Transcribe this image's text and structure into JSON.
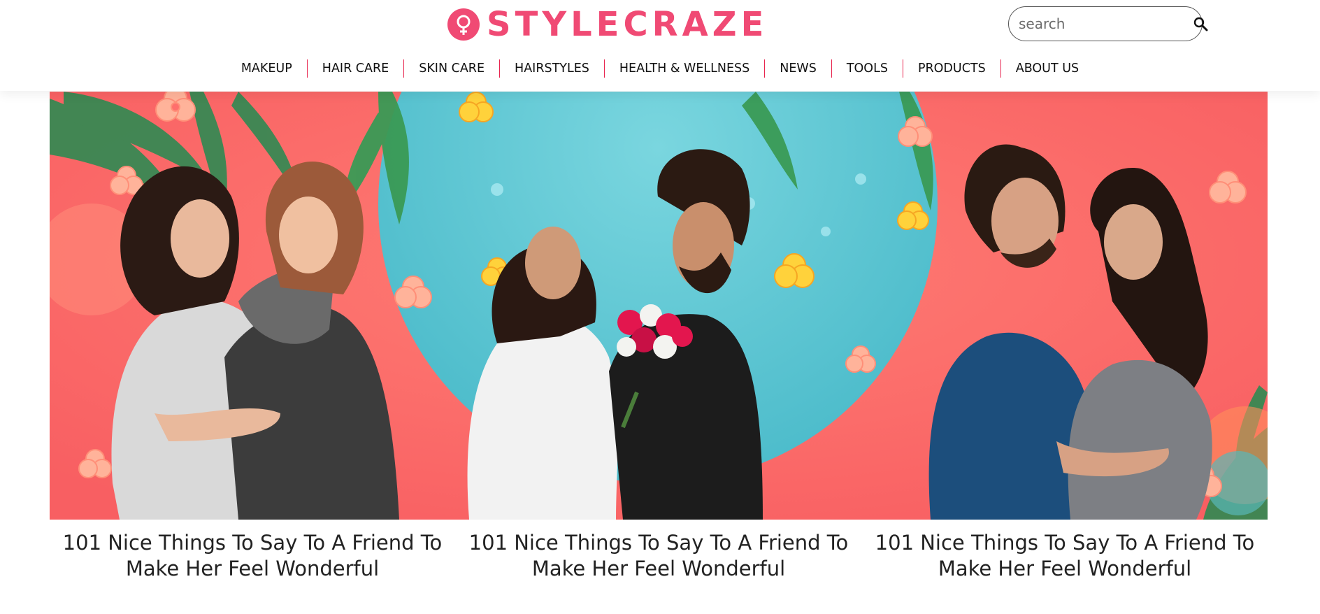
{
  "brand": {
    "name": "STYLECRAZE",
    "color": "#f04a74"
  },
  "search": {
    "placeholder": "search",
    "value": "",
    "icon": "search-icon"
  },
  "nav": {
    "items": [
      {
        "label": "MAKEUP"
      },
      {
        "label": "HAIR CARE"
      },
      {
        "label": "SKIN CARE"
      },
      {
        "label": "HAIRSTYLES"
      },
      {
        "label": "HEALTH & WELLNESS"
      },
      {
        "label": "NEWS"
      },
      {
        "label": "TOOLS"
      },
      {
        "label": "PRODUCTS"
      },
      {
        "label": "ABOUT US"
      }
    ],
    "separator_color": "#e8254f"
  },
  "hero": {
    "colors": {
      "coral": "#ff6f6c",
      "sky": "#5ec9d6",
      "leaf": "#2f8a52",
      "flower": "#ff9c8a"
    }
  },
  "articles": [
    {
      "title": "101 Nice Things To Say To A Friend To Make Her Feel Wonderful"
    },
    {
      "title": "101 Nice Things To Say To A Friend To Make Her Feel Wonderful"
    },
    {
      "title": "101 Nice Things To Say To A Friend To Make Her Feel Wonderful"
    }
  ]
}
